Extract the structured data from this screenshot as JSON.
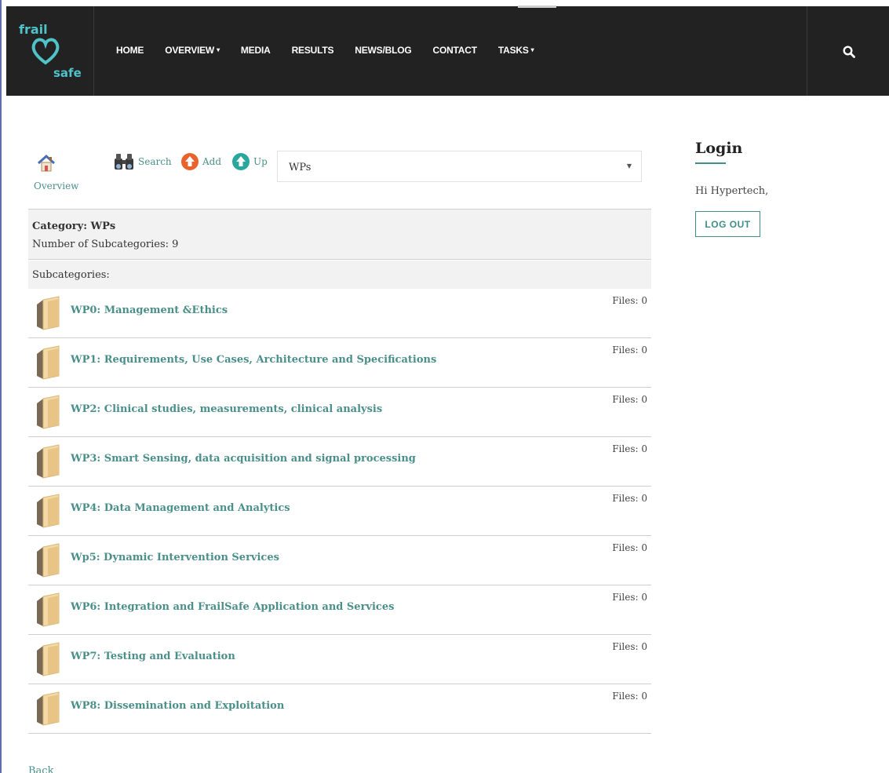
{
  "header": {
    "logo_top": "frail",
    "logo_bottom": "safe",
    "nav": [
      {
        "label": "HOME",
        "dropdown": false
      },
      {
        "label": "OVERVIEW",
        "dropdown": true
      },
      {
        "label": "MEDIA",
        "dropdown": false
      },
      {
        "label": "RESULTS",
        "dropdown": false
      },
      {
        "label": "NEWS/BLOG",
        "dropdown": false
      },
      {
        "label": "CONTACT",
        "dropdown": false
      },
      {
        "label": "TASKS",
        "dropdown": true
      }
    ],
    "search_icon": "search-icon"
  },
  "toolbar": {
    "overview_label": "Overview",
    "search_label": "Search",
    "add_label": "Add",
    "up_label": "Up",
    "category_select": "WPs"
  },
  "category": {
    "title": "Category: WPs",
    "count": "Number of Subcategories: 9",
    "subcategories_label": "Subcategories:"
  },
  "subcategories": [
    {
      "title": "WP0: Management &Ethics",
      "files": "Files: 0"
    },
    {
      "title": "WP1: Requirements, Use Cases, Architecture and Specifications",
      "files": "Files: 0"
    },
    {
      "title": "WP2: Clinical studies, measurements, clinical analysis",
      "files": "Files: 0"
    },
    {
      "title": "WP3: Smart Sensing, data acquisition and signal processing",
      "files": "Files: 0"
    },
    {
      "title": "WP4: Data Management and Analytics",
      "files": "Files: 0"
    },
    {
      "title": "Wp5: Dynamic Intervention Services",
      "files": "Files: 0"
    },
    {
      "title": "WP6: Integration and FrailSafe Application and Services",
      "files": "Files: 0"
    },
    {
      "title": "WP7: Testing and Evaluation",
      "files": "Files: 0"
    },
    {
      "title": "WP8: Dissemination and Exploitation",
      "files": "Files: 0"
    }
  ],
  "back_label": "Back",
  "sidebar": {
    "login_title": "Login",
    "greeting": "Hi Hypertech,",
    "logout_label": "LOG OUT"
  },
  "colors": {
    "accent": "#3e8e88",
    "header_bg": "#222222",
    "link": "#4a8f8a"
  }
}
